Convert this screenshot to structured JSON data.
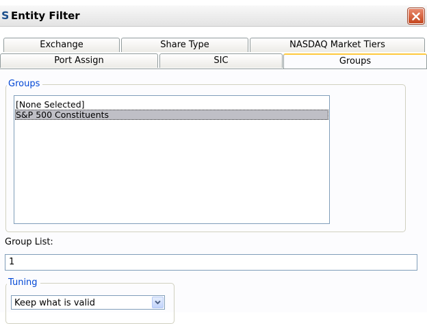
{
  "window": {
    "title": "Entity Filter",
    "app_icon_glyph": "S",
    "icons": {
      "app": "app-icon",
      "close": "close-icon"
    }
  },
  "tabs": {
    "back_row": [
      {
        "label": "Exchange"
      },
      {
        "label": "Share Type"
      },
      {
        "label": "NASDAQ Market Tiers"
      }
    ],
    "front_row": [
      {
        "label": "Port Assign"
      },
      {
        "label": "SIC"
      },
      {
        "label": "Groups",
        "active": true
      }
    ]
  },
  "groups_panel": {
    "legend": "Groups",
    "items": [
      {
        "label": "[None Selected]",
        "selected": false
      },
      {
        "label": "S&P 500 Constituents",
        "selected": true
      }
    ]
  },
  "group_list": {
    "label": "Group List:",
    "value": "1"
  },
  "tuning": {
    "legend": "Tuning",
    "selected": "Keep what is valid"
  },
  "colors": {
    "legend_text": "#0046d5",
    "active_tab_accent": "#ffc83c",
    "close_button": "#c5471f",
    "selection": "#bfbfc6"
  }
}
